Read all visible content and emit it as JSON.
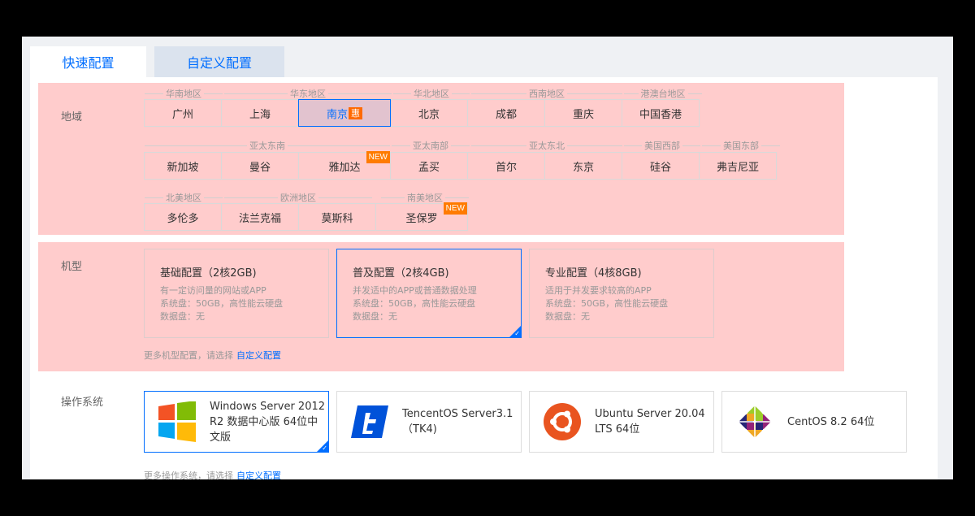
{
  "tabs": [
    "快速配置",
    "自定义配置"
  ],
  "region": {
    "label": "地域",
    "rows": [
      {
        "groups": [
          "华南地区",
          "华东地区",
          "华北地区",
          "西南地区",
          "港澳台地区"
        ],
        "items": [
          {
            "name": "广州"
          },
          {
            "name": "上海"
          },
          {
            "name": "南京",
            "badge": "惠",
            "selected": true
          },
          {
            "name": "北京"
          },
          {
            "name": "成都"
          },
          {
            "name": "重庆"
          },
          {
            "name": "中国香港"
          }
        ]
      },
      {
        "groups": [
          "亚太东南",
          "亚太南部",
          "亚太东北",
          "美国西部",
          "美国东部"
        ],
        "items": [
          {
            "name": "新加坡"
          },
          {
            "name": "曼谷"
          },
          {
            "name": "雅加达",
            "new": "NEW"
          },
          {
            "name": "孟买"
          },
          {
            "name": "首尔"
          },
          {
            "name": "东京"
          },
          {
            "name": "硅谷"
          },
          {
            "name": "弗吉尼亚"
          }
        ]
      },
      {
        "groups": [
          "北美地区",
          "欧洲地区",
          "南美地区"
        ],
        "items": [
          {
            "name": "多伦多"
          },
          {
            "name": "法兰克福"
          },
          {
            "name": "莫斯科"
          },
          {
            "name": "圣保罗",
            "new": "NEW"
          }
        ]
      }
    ]
  },
  "machine": {
    "label": "机型",
    "cards": [
      {
        "title": "基础配置（2核2GB)",
        "lines": [
          "有一定访问量的网站或APP",
          "系统盘：50GB，高性能云硬盘",
          "数据盘：无"
        ]
      },
      {
        "title": "普及配置（2核4GB)",
        "lines": [
          "并发适中的APP或普通数据处理",
          "系统盘：50GB，高性能云硬盘",
          "数据盘：无"
        ],
        "selected": true
      },
      {
        "title": "专业配置（4核8GB)",
        "lines": [
          "适用于并发要求较高的APP",
          "系统盘：50GB，高性能云硬盘",
          "数据盘：无"
        ]
      }
    ],
    "more_text": "更多机型配置，请选择",
    "more_link": "自定义配置"
  },
  "os": {
    "label": "操作系统",
    "items": [
      {
        "name": "Windows Server 2012 R2 数据中心版 64位中文版",
        "icon": "windows-icon",
        "selected": true
      },
      {
        "name": "TencentOS Server3.1 （TK4)",
        "icon": "tencentos-icon"
      },
      {
        "name": "Ubuntu Server 20.04 LTS 64位",
        "icon": "ubuntu-icon"
      },
      {
        "name": "CentOS 8.2 64位",
        "icon": "centos-icon"
      }
    ],
    "more_text": "更多操作系统，请选择",
    "more_link": "自定义配置"
  },
  "colors": {
    "accent": "#006eff",
    "highlight": "#ffcccc",
    "badge": "#ff6a00"
  }
}
